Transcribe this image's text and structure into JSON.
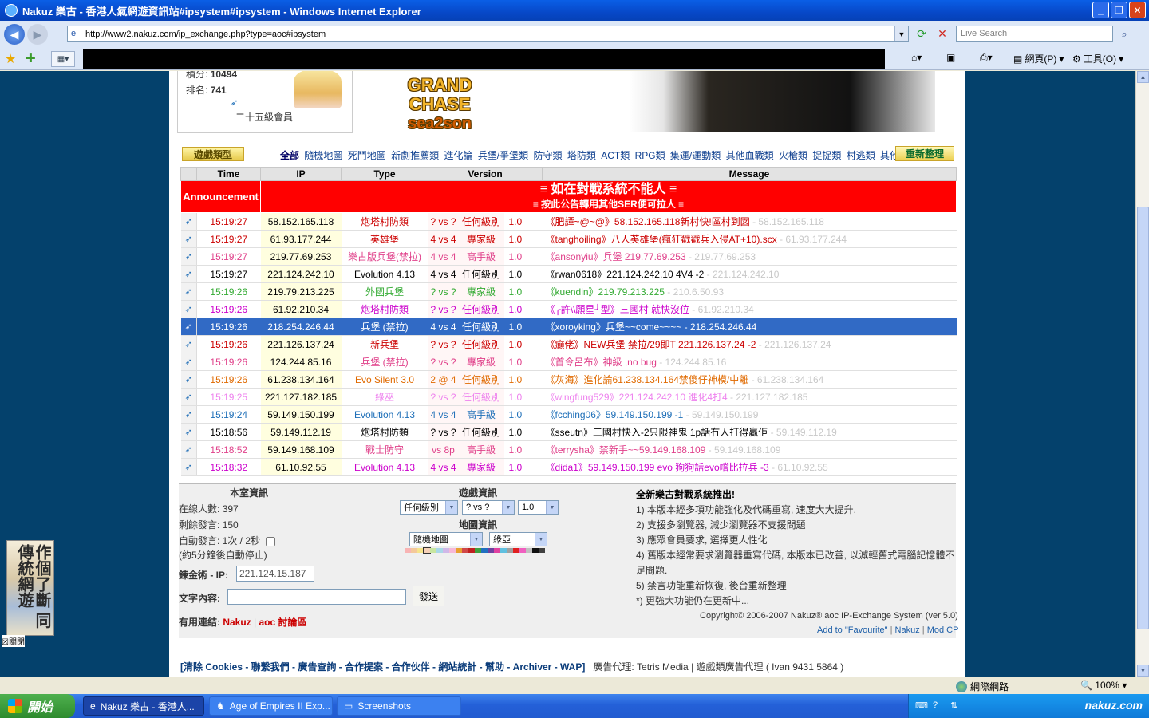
{
  "window": {
    "title": "Nakuz 樂古 - 香港人氣網遊資訊站#ipsystem#ipsystem - Windows Internet Explorer",
    "url": "http://www2.nakuz.com/ip_exchange.php?type=aoc#ipsystem",
    "search_placeholder": "Live Search",
    "cmd_page": "網頁(P)",
    "cmd_tools": "工具(O)"
  },
  "user": {
    "points_label": "積分:",
    "points": "10494",
    "rank_label": "排名:",
    "rank": "741",
    "member_level": "二十五級會員"
  },
  "banner": {
    "line1": "GRAND CHASE",
    "line2": "sea2son"
  },
  "categories": {
    "title": "遊戲類型",
    "items": [
      "全部",
      "隨機地圖",
      "死鬥地圖",
      "新劇推薦類",
      "進化論",
      "兵堡/爭堡類",
      "防守類",
      "塔防類",
      "ACT類",
      "RPG類",
      "集運/運動類",
      "其他血戰類",
      "火槍類",
      "捉捉類",
      "村逃類",
      "其他"
    ],
    "refresh": "重新整理"
  },
  "table": {
    "headers": {
      "time": "Time",
      "ip": "IP",
      "type": "Type",
      "version": "Version",
      "message": "Message"
    },
    "announcement": {
      "label": "Announcement",
      "line1": "≡ 如在對戰系統不能人 ≡",
      "line2": "≡ 按此公告轉用其他SER便可拉人 ≡"
    },
    "rows": [
      {
        "time": "15:19:27",
        "ip": "58.152.165.118",
        "type": "炮塔村防類",
        "players": "? vs ?",
        "level": "任何級別",
        "version": "1.0",
        "msg": "《肥譚~@~@》58.152.165.118新村快!區村到囡",
        "msg_ip": " - 58.152.165.118",
        "color": "#CC0000"
      },
      {
        "time": "15:19:27",
        "ip": "61.93.177.244",
        "type": "英雄堡",
        "players": "4 vs 4",
        "level": "專家級",
        "version": "1.0",
        "msg": "《tanghoiling》八人英雄堡(瘋狂戳戳兵入侵AT+10).scx",
        "msg_ip": " - 61.93.177.244",
        "color": "#CC0000"
      },
      {
        "time": "15:19:27",
        "ip": "219.77.69.253",
        "type": "樂古版兵堡(禁拉)",
        "players": "4 vs 4",
        "level": "高手級",
        "version": "1.0",
        "msg": "《ansonyiu》兵堡 219.77.69.253",
        "msg_ip": " - 219.77.69.253",
        "color": "#E0408A"
      },
      {
        "time": "15:19:27",
        "ip": "221.124.242.10",
        "type": "Evolution 4.13",
        "players": "4 vs 4",
        "level": "任何級別",
        "version": "1.0",
        "msg": "《rwan0618》221.124.242.10 4V4 -2",
        "msg_ip": " - 221.124.242.10",
        "color": "#000000"
      },
      {
        "time": "15:19:26",
        "ip": "219.79.213.225",
        "type": "外國兵堡",
        "players": "? vs ?",
        "level": "專家級",
        "version": "1.0",
        "msg": "《kuendin》219.79.213.225",
        "msg_ip": " - 210.6.50.93",
        "color": "#33AA33"
      },
      {
        "time": "15:19:26",
        "ip": "61.92.210.34",
        "type": "炮塔村防類",
        "players": "? vs ?",
        "level": "任何級別",
        "version": "1.0",
        "msg": "《╭許\\\\願星╯型》三國村 就快沒位",
        "msg_ip": " - 61.92.210.34",
        "color": "#CC00CC"
      },
      {
        "time": "15:19:26",
        "ip": "218.254.246.44",
        "type": "兵堡 (禁拉)",
        "players": "4 vs 4",
        "level": "任何級別",
        "version": "1.0",
        "msg": "《xoroyking》兵堡~~come~~~~",
        "msg_ip": " - 218.254.246.44",
        "color": "#FFFFFF",
        "selected": true
      },
      {
        "time": "15:19:26",
        "ip": "221.126.137.24",
        "type": "新兵堡",
        "players": "? vs ?",
        "level": "任何級別",
        "version": "1.0",
        "msg": "《癲佬》NEW兵堡 禁拉/29即T 221.126.137.24 -2",
        "msg_ip": " - 221.126.137.24",
        "color": "#CC0000"
      },
      {
        "time": "15:19:26",
        "ip": "124.244.85.16",
        "type": "兵堡 (禁拉)",
        "players": "? vs ?",
        "level": "專家級",
        "version": "1.0",
        "msg": "《首令呂布》神級 ,no bug",
        "msg_ip": " - 124.244.85.16",
        "color": "#E0408A"
      },
      {
        "time": "15:19:26",
        "ip": "61.238.134.164",
        "type": "Evo Silent 3.0",
        "players": "2 @ 4",
        "level": "任何級別",
        "version": "1.0",
        "msg": "《灰海》進化論61.238.134.164禁傻仔神模/中離",
        "msg_ip": " - 61.238.134.164",
        "color": "#E06A00"
      },
      {
        "time": "15:19:25",
        "ip": "221.127.182.185",
        "type": "綠巫",
        "players": "? vs ?",
        "level": "任何級別",
        "version": "1.0",
        "msg": "《wingfung529》221.124.242.10 進化4打4",
        "msg_ip": " - 221.127.182.185",
        "color": "#EE82EE"
      },
      {
        "time": "15:19:24",
        "ip": "59.149.150.199",
        "type": "Evolution 4.13",
        "players": "4 vs 4",
        "level": "高手級",
        "version": "1.0",
        "msg": "《fcching06》59.149.150.199 -1",
        "msg_ip": " - 59.149.150.199",
        "color": "#1E6FB8"
      },
      {
        "time": "15:18:56",
        "ip": "59.149.112.19",
        "type": "炮塔村防類",
        "players": "? vs ?",
        "level": "任何級別",
        "version": "1.0",
        "msg": "《sseutn》三國村快入-2只限神鬼 1p話冇人打得贏佢",
        "msg_ip": " - 59.149.112.19",
        "color": "#000000"
      },
      {
        "time": "15:18:52",
        "ip": "59.149.168.109",
        "type": "戰士防守",
        "players": "vs 8p",
        "level": "高手級",
        "version": "1.0",
        "msg": "《terrysha》禁新手~~59.149.168.109",
        "msg_ip": " - 59.149.168.109",
        "color": "#E0408A"
      },
      {
        "time": "15:18:32",
        "ip": "61.10.92.55",
        "type": "Evolution 4.13",
        "players": "4 vs 4",
        "level": "專家級",
        "version": "1.0",
        "msg": "《dida1》59.149.150.199 evo 狗狗話evo嚐比拉兵 -3",
        "msg_ip": " - 61.10.92.55",
        "color": "#CC00CC"
      }
    ]
  },
  "room": {
    "title": "本室資訊",
    "online_label": "在線人數:",
    "online": "397",
    "remain_label": "剩餘發言:",
    "remain": "150",
    "auto_label": "自動發言: 1次 / 2秒",
    "auto_note": "(約5分鐘後自動停止)",
    "ip_label": "鍊金術 - IP:",
    "ip_value": "221.124.15.187",
    "text_label": "文字內容:",
    "send": "發送",
    "links_label": "有用連結:",
    "link1": "Nakuz",
    "link2": "aoc 討論區"
  },
  "game_info": {
    "title": "遊戲資訊",
    "level": "任何級別",
    "players": "? vs ?",
    "version": "1.0",
    "map_title": "地圖資訊",
    "map": "隨機地圖",
    "map_color": "綠亞"
  },
  "news": {
    "title": "全新樂古對戰系統推出!",
    "items": [
      "1) 本版本經多項功能強化及代碼重寫, 速度大大提升.",
      "2) 支援多瀏覽器, 減少瀏覽器不支援問題",
      "3) 應眾會員要求, 選擇更人性化",
      "4) 舊版本經常要求瀏覽器重寫代碼, 本版本已改善, 以減輕舊式電腦記憶體不足問題.",
      "5) 禁言功能重新恢復, 後台重新整理",
      "*) 更強大功能仍在更新中..."
    ],
    "copyright": "Copyright© 2006-2007  Nakuz® aoc IP-Exchange System (ver 5.0)",
    "add_fav": "Add to \"Favourite\"",
    "nakuz": "Nakuz",
    "mod": "Mod CP"
  },
  "footer": {
    "text": "[清除 Cookies - 聯繫我們 - 廣告查詢 - 合作提案 - 合作伙伴 - 網站統計 - 幫助 - Archiver - WAP]",
    "agent": "廣告代理: Tetris Media | 遊戲類廣告代理 ( Ivan 9431 5864 )"
  },
  "side_ad": {
    "text": "作個了斷 同傳統網遊",
    "close": "關閉"
  },
  "statusbar": {
    "zone": "網際網路",
    "zoom": "100%"
  },
  "taskbar": {
    "start": "開始",
    "tasks": [
      "Nakuz 樂古 - 香港人...",
      "Age of Empires II Exp...",
      "Screenshots"
    ],
    "brand": "nakuz.com"
  },
  "colors": {
    "accent": "#0748C8",
    "page_bg": "#04416C",
    "announcement": "#FF0000",
    "selected": "#316AC5"
  }
}
